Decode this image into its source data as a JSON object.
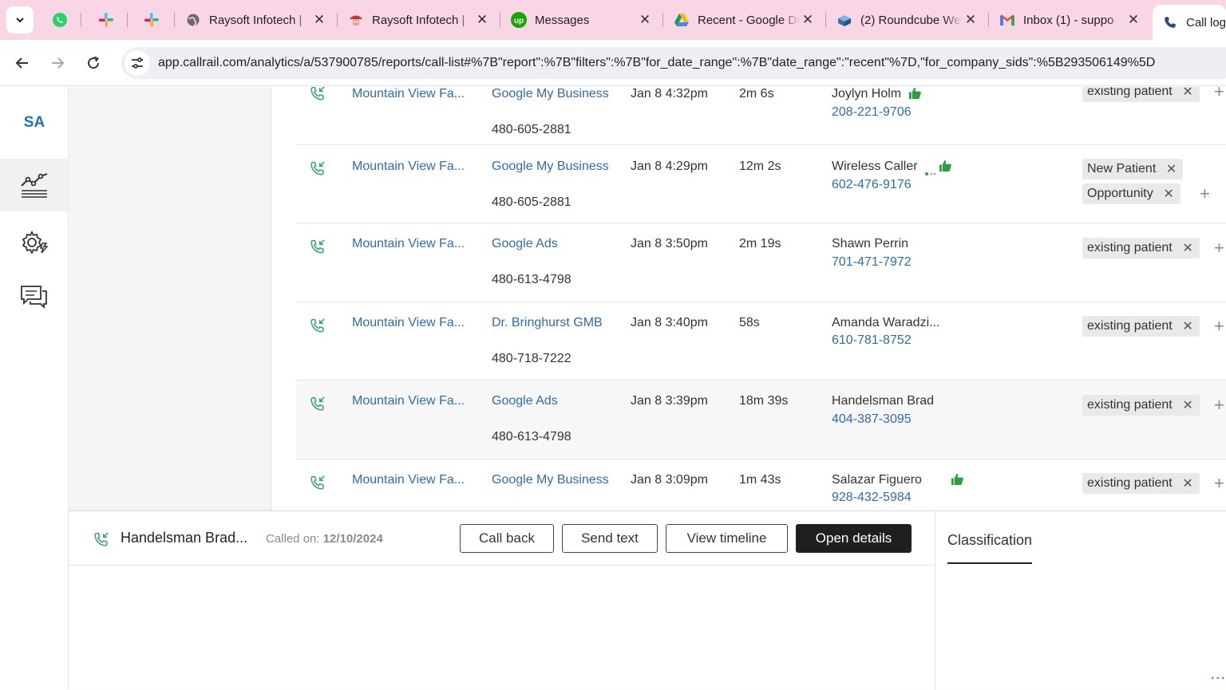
{
  "browser": {
    "tabs": [
      {
        "title": "Raysoft Infotech | ",
        "icon": "globe-icon"
      },
      {
        "title": "Raysoft Infotech | ",
        "icon": "raysoft-icon"
      },
      {
        "title": "Messages",
        "icon": "upwork-icon"
      },
      {
        "title": "Recent - Google Dr",
        "icon": "google-drive-icon"
      },
      {
        "title": "(2) Roundcube We",
        "icon": "roundcube-icon"
      },
      {
        "title": "Inbox (1) - suppo",
        "icon": "gmail-icon"
      },
      {
        "title": "Call log",
        "icon": "callrail-icon"
      }
    ],
    "pinned": [
      "whatsapp-icon",
      "slack-icon",
      "slack-icon"
    ],
    "url": "app.callrail.com/analytics/a/537900785/reports/call-list#%7B\"report\":%7B\"filters\":%7B\"for_date_range\":%7B\"date_range\":\"recent\"%7D,\"for_company_sids\":%5B293506149%5D"
  },
  "sidenav": {
    "avatar": "SA",
    "items": [
      "analytics-icon",
      "settings-icon",
      "conversations-icon"
    ]
  },
  "calls": [
    {
      "company": "Mountain View Fa...",
      "source": "Google My Business",
      "tracking": "480-605-2881",
      "date": "Jan 8 4:32pm",
      "duration": "2m 6s",
      "caller": "Joylyn Holm",
      "phone": "208-221-9706",
      "thumb": true,
      "tags": [
        "existing patient"
      ]
    },
    {
      "company": "Mountain View Fa...",
      "source": "Google My Business",
      "tracking": "480-605-2881",
      "date": "Jan 8 4:29pm",
      "duration": "12m 2s",
      "caller": "Wireless Caller",
      "phone": "602-476-9176",
      "thumb": true,
      "tags": [
        "New Patient",
        "Opportunity"
      ]
    },
    {
      "company": "Mountain View Fa...",
      "source": "Google Ads",
      "tracking": "480-613-4798",
      "date": "Jan 8 3:50pm",
      "duration": "2m 19s",
      "caller": "Shawn Perrin",
      "phone": "701-471-7972",
      "thumb": false,
      "tags": [
        "existing patient"
      ]
    },
    {
      "company": "Mountain View Fa...",
      "source": "Dr. Bringhurst GMB",
      "tracking": "480-718-7222",
      "date": "Jan 8 3:40pm",
      "duration": "58s",
      "caller": "Amanda Waradzi...",
      "phone": "610-781-8752",
      "thumb": false,
      "tags": [
        "existing patient"
      ]
    },
    {
      "company": "Mountain View Fa...",
      "source": "Google Ads",
      "tracking": "480-613-4798",
      "date": "Jan 8 3:39pm",
      "duration": "18m 39s",
      "caller": "Handelsman Brad",
      "phone": "404-387-3095",
      "thumb": false,
      "tags": [
        "existing patient"
      ]
    },
    {
      "company": "Mountain View Fa...",
      "source": "Google My Business",
      "tracking": "",
      "date": "Jan 8 3:09pm",
      "duration": "1m 43s",
      "caller": "Salazar Figuero",
      "phone": "928-432-5984",
      "thumb": true,
      "tags": [
        "existing patient"
      ]
    }
  ],
  "drawer": {
    "caller_name": "Handelsman Brad...",
    "called_on_label": "Called on:",
    "called_on_date": "12/10/2024",
    "call_back": "Call back",
    "send_text": "Send text",
    "view_timeline": "View timeline",
    "open_details": "Open details",
    "classification_tab": "Classification",
    "more": "..."
  },
  "colors": {
    "tabbar": "#f9d6e6",
    "link": "#2f6bb3",
    "call_icon_green": "#2fa36b",
    "thumb_green": "#2e9f3e"
  }
}
